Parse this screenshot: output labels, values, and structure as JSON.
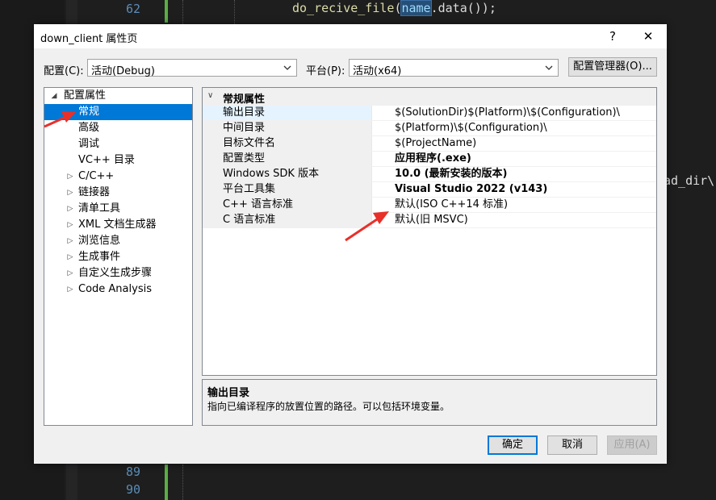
{
  "editor": {
    "line_numbers_top": [
      "62"
    ],
    "line_numbers_bottom": [
      "89",
      "90"
    ],
    "code": {
      "fn": "do_recive_file",
      "paren_open": "(",
      "highlight": "name",
      "rest": ".data());"
    },
    "right_fragment": "ad_dir\\"
  },
  "dialog": {
    "title": "down_client 属性页",
    "help_label": "?",
    "close_label": "✕",
    "config_label": "配置(C):",
    "config_value": "活动(Debug)",
    "platform_label": "平台(P):",
    "platform_value": "活动(x64)",
    "config_manager_label": "配置管理器(O)...",
    "tree": {
      "root": "配置属性",
      "items": [
        {
          "label": "常规",
          "selected": true,
          "expander": ""
        },
        {
          "label": "高级",
          "expander": ""
        },
        {
          "label": "调试",
          "expander": ""
        },
        {
          "label": "VC++ 目录",
          "expander": ""
        },
        {
          "label": "C/C++",
          "expander": "▷"
        },
        {
          "label": "链接器",
          "expander": "▷"
        },
        {
          "label": "清单工具",
          "expander": "▷"
        },
        {
          "label": "XML 文档生成器",
          "expander": "▷"
        },
        {
          "label": "浏览信息",
          "expander": "▷"
        },
        {
          "label": "生成事件",
          "expander": "▷"
        },
        {
          "label": "自定义生成步骤",
          "expander": "▷"
        },
        {
          "label": "Code Analysis",
          "expander": "▷"
        }
      ]
    },
    "grid": {
      "section": "常规属性",
      "rows": [
        {
          "key": "输出目录",
          "value": "$(SolutionDir)$(Platform)\\$(Configuration)\\",
          "bold": false
        },
        {
          "key": "中间目录",
          "value": "$(Platform)\\$(Configuration)\\",
          "bold": false
        },
        {
          "key": "目标文件名",
          "value": "$(ProjectName)",
          "bold": false
        },
        {
          "key": "配置类型",
          "value": "应用程序(.exe)",
          "bold": true
        },
        {
          "key": "Windows SDK 版本",
          "value": "10.0 (最新安装的版本)",
          "bold": true
        },
        {
          "key": "平台工具集",
          "value": "Visual Studio 2022 (v143)",
          "bold": true
        },
        {
          "key": "C++ 语言标准",
          "value": "默认(ISO C++14 标准)",
          "bold": false
        },
        {
          "key": "C 语言标准",
          "value": "默认(旧 MSVC)",
          "bold": false
        }
      ]
    },
    "description": {
      "title": "输出目录",
      "text": "指向已编译程序的放置位置的路径。可以包括环境变量。"
    },
    "ok_label": "确定",
    "cancel_label": "取消",
    "apply_label": "应用(A)"
  },
  "colors": {
    "selection": "#0078d7",
    "annotation_arrow": "#e8302a"
  }
}
